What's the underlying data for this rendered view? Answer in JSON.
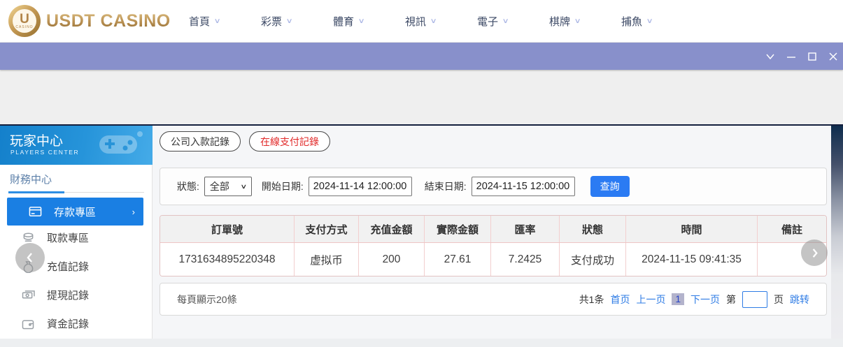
{
  "header": {
    "logo_text": "USDT CASINO",
    "logo_u": "U",
    "logo_coin_sub": "CASINO",
    "nav_items": [
      {
        "label": "首頁"
      },
      {
        "label": "彩票"
      },
      {
        "label": "體育"
      },
      {
        "label": "視訊"
      },
      {
        "label": "電子"
      },
      {
        "label": "棋牌"
      },
      {
        "label": "捕魚"
      }
    ]
  },
  "sidebar": {
    "title": "玩家中心",
    "subtitle": "PLAYERS CENTER",
    "section": "財務中心",
    "active_item": {
      "label": "存款專區",
      "arrow": "›"
    },
    "items": [
      {
        "label": "取款專區"
      },
      {
        "label": "充值記錄"
      },
      {
        "label": "提現記錄"
      },
      {
        "label": "資金記錄"
      }
    ]
  },
  "tabs": [
    {
      "label": "公司入款記錄",
      "active": false
    },
    {
      "label": "在線支付記錄",
      "active": true
    }
  ],
  "filters": {
    "status_label": "狀態:",
    "status_value": "全部",
    "start_label": "開始日期:",
    "start_value": "2024-11-14 12:00:00",
    "end_label": "結束日期:",
    "end_value": "2024-11-15 12:00:00",
    "search_button": "查詢"
  },
  "table": {
    "headers": [
      "訂單號",
      "支付方式",
      "充值金額",
      "實際金額",
      "匯率",
      "狀態",
      "時間",
      "備註"
    ],
    "rows": [
      [
        "1731634895220348",
        "虚拟币",
        "200",
        "27.61",
        "7.2425",
        "支付成功",
        "2024-11-15 09:41:35",
        ""
      ]
    ]
  },
  "pagination": {
    "per_page": "每頁顯示20條",
    "total": "共1条",
    "first": "首页",
    "prev": "上一页",
    "current": "1",
    "next": "下一页",
    "jump_pre": "第",
    "jump_post": "页",
    "jump_button": "跳转"
  },
  "colors": {
    "titlebar_purple": "#8890cb",
    "sidebar_header_blue": "#1480cb",
    "active_item_blue": "#1a7fe3",
    "query_button_blue": "#2b7bf3",
    "link_blue": "#2f7ce5",
    "tab_active_red": "#e22a2a",
    "table_border_pink": "#f2cfcf",
    "logo_gold": "#b78e50"
  }
}
